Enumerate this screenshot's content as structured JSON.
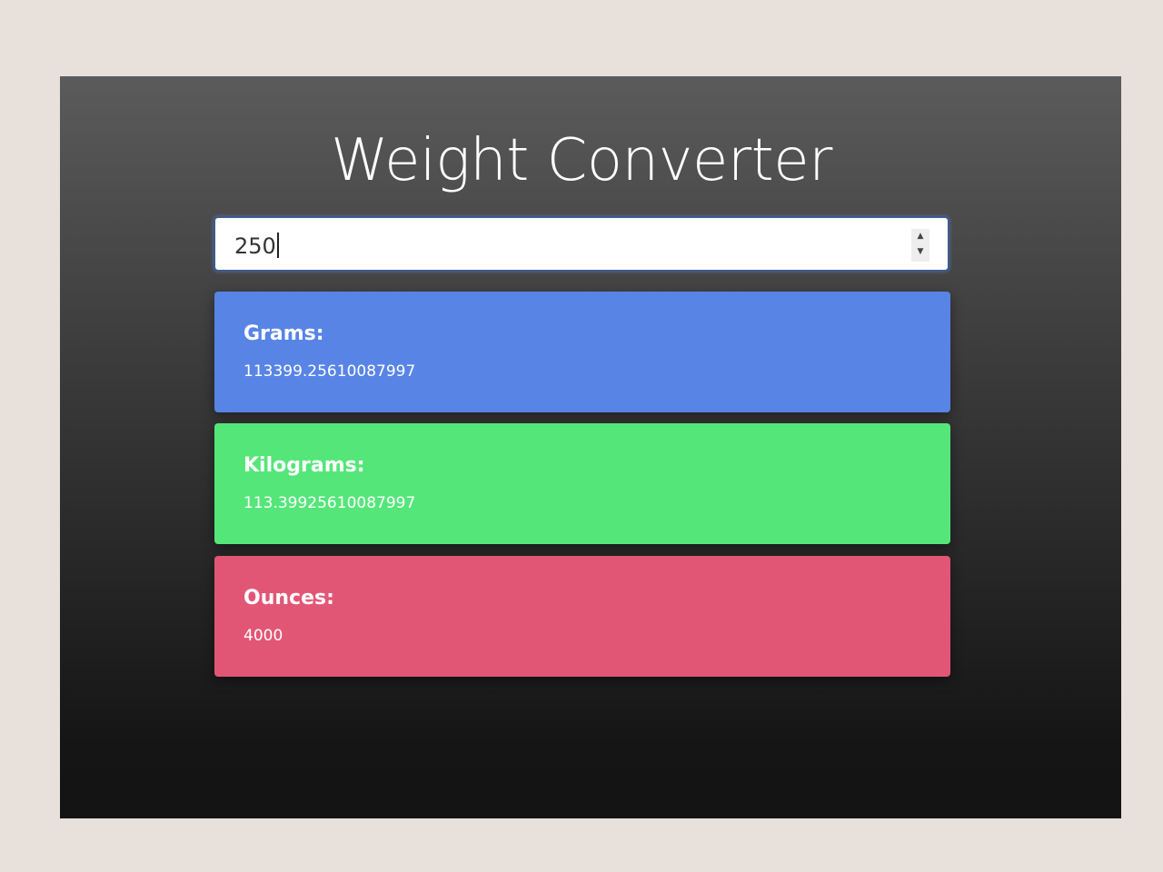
{
  "title": "Weight Converter",
  "input": {
    "value": "250"
  },
  "results": [
    {
      "label": "Grams:",
      "value": "113399.25610087997",
      "color": "#5884e5"
    },
    {
      "label": "Kilograms:",
      "value": "113.39925610087997",
      "color": "#55e67a"
    },
    {
      "label": "Ounces:",
      "value": "4000",
      "color": "#e25675"
    }
  ]
}
